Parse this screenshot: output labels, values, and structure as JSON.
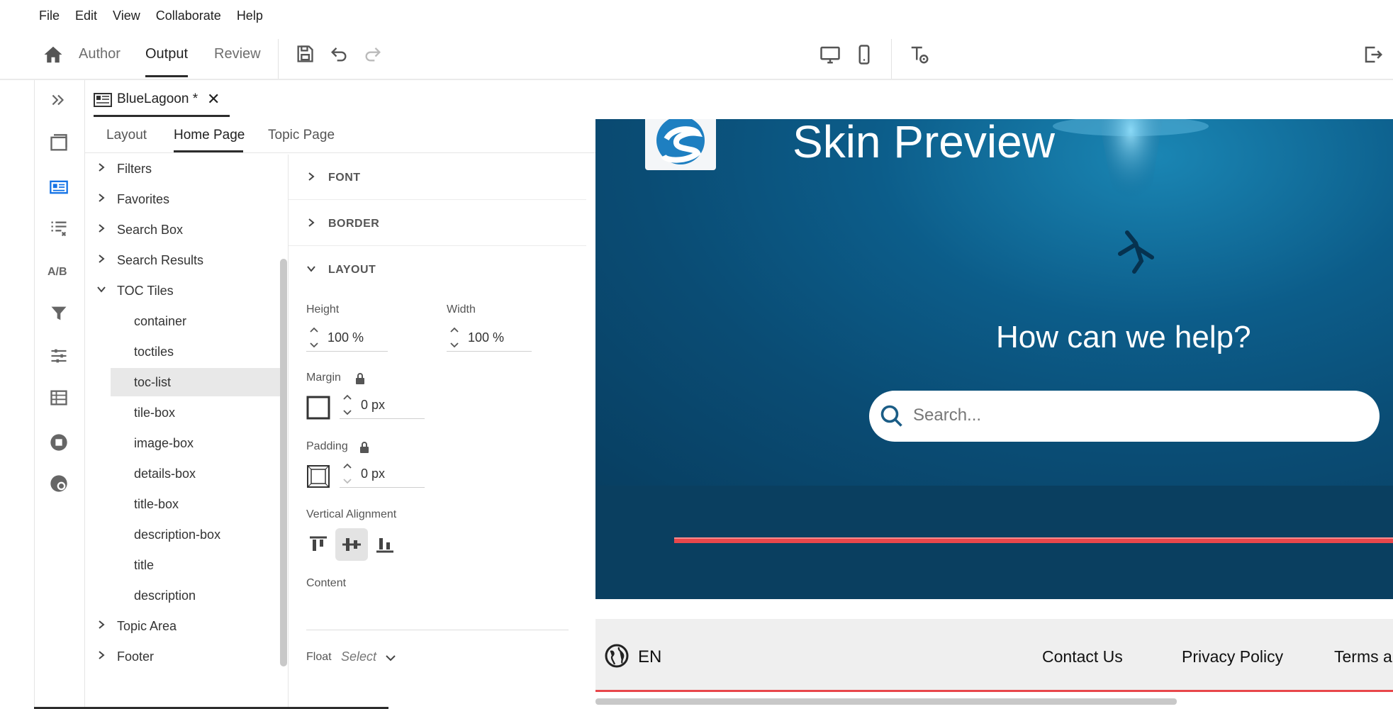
{
  "menu": {
    "items": [
      "File",
      "Edit",
      "View",
      "Collaborate",
      "Help"
    ]
  },
  "toolbar": {
    "home_icon": "home-icon",
    "modes": [
      "Author",
      "Output",
      "Review"
    ],
    "active_mode": "Output",
    "icons": [
      "save-icon",
      "undo-icon",
      "redo-icon",
      "desktop-preview-icon",
      "mobile-preview-icon",
      "text-preview-icon",
      "exit-icon"
    ]
  },
  "rail": {
    "ab_label": "A/B",
    "icons": [
      "expand-icon",
      "window-icon",
      "skin-icon",
      "toc-icon",
      "ab-icon",
      "filter-icon",
      "settings-icon",
      "table-icon",
      "stop-icon",
      "color-icon"
    ]
  },
  "document": {
    "title": "BlueLagoon *",
    "close": "✕"
  },
  "subtabs": {
    "items": [
      "Layout",
      "Home Page",
      "Topic Page"
    ],
    "active": "Home Page"
  },
  "tree": {
    "items": [
      {
        "label": "Filters",
        "level": 0,
        "expanded": false
      },
      {
        "label": "Favorites",
        "level": 0,
        "expanded": false
      },
      {
        "label": "Search Box",
        "level": 0,
        "expanded": false
      },
      {
        "label": "Search Results",
        "level": 0,
        "expanded": false
      },
      {
        "label": "TOC Tiles",
        "level": 0,
        "expanded": true
      },
      {
        "label": "container",
        "level": 1
      },
      {
        "label": "toctiles",
        "level": 1
      },
      {
        "label": "toc-list",
        "level": 1,
        "selected": true
      },
      {
        "label": "tile-box",
        "level": 1
      },
      {
        "label": "image-box",
        "level": 1
      },
      {
        "label": "details-box",
        "level": 1
      },
      {
        "label": "title-box",
        "level": 1
      },
      {
        "label": "description-box",
        "level": 1
      },
      {
        "label": "title",
        "level": 1
      },
      {
        "label": "description",
        "level": 1
      },
      {
        "label": "Topic Area",
        "level": 0,
        "expanded": false
      },
      {
        "label": "Footer",
        "level": 0,
        "expanded": false
      }
    ]
  },
  "props": {
    "sections": {
      "font": "FONT",
      "border": "BORDER",
      "layout": "LAYOUT"
    },
    "height_label": "Height",
    "height_value": "100 %",
    "width_label": "Width",
    "width_value": "100 %",
    "margin_label": "Margin",
    "margin_value": "0 px",
    "padding_label": "Padding",
    "padding_value": "0 px",
    "valign_label": "Vertical Alignment",
    "valign_active": "middle",
    "content_label": "Content",
    "float_label": "Float",
    "float_placeholder": "Select"
  },
  "preview": {
    "title": "Skin Preview",
    "subtitle": "How can we help?",
    "search_placeholder": "Search...",
    "language": "EN",
    "footer_links": [
      "Contact Us",
      "Privacy Policy",
      "Terms a"
    ],
    "colors": {
      "hero": "#0a4c74",
      "band": "#0a3f60",
      "accent_line": "#e8474b",
      "footer_bg": "#efefef"
    }
  }
}
